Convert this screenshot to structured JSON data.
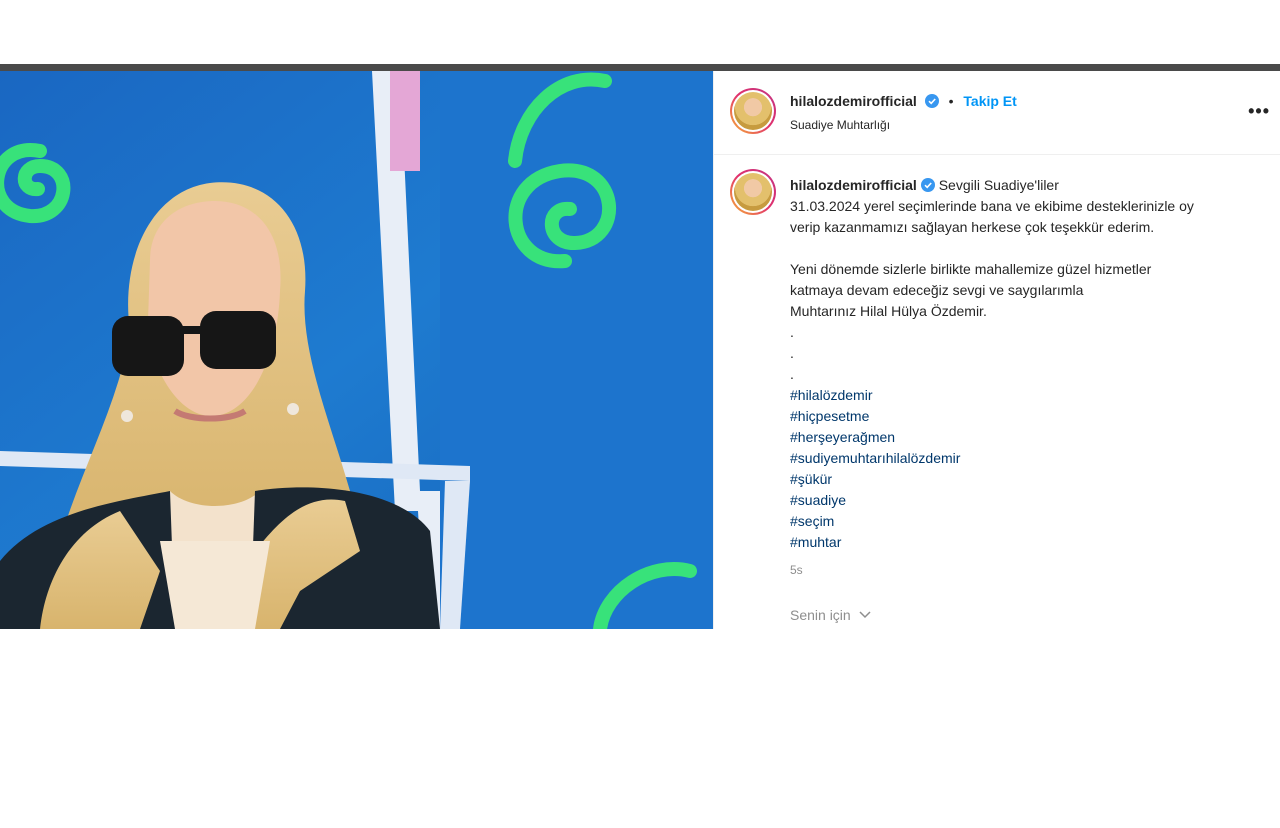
{
  "post": {
    "username": "hilalozdemirofficial",
    "follow_label": "Takip Et",
    "separator": "•",
    "location": "Suadiye Muhtarlığı",
    "more_label": "•••",
    "caption_lines": [
      "Sevgili Suadiye'liler",
      "31.03.2024 yerel seçimlerinde bana ve ekibime desteklerinizle oy",
      "verip kazanmamızı sağlayan herkese çok teşekkür ederim.",
      "",
      "Yeni dönemde sizlerle birlikte mahallemize güzel hizmetler",
      "katmaya devam edeceğiz sevgi ve saygılarımla",
      "Muhtarınız Hilal Hülya Özdemir.",
      ".",
      ".",
      "."
    ],
    "hashtags": [
      "#hilalözdemir",
      "#hiçpesetme",
      "#herşeyerağmen",
      "#sudiyemuhtarıhilalözdemir",
      "#şükür",
      "#suadiye",
      "#seçim",
      "#muhtar"
    ],
    "time": "5s",
    "for_you": "Senin için",
    "icons": {
      "verified": "verified-badge-icon",
      "more": "more-options-icon",
      "chevron": "chevron-down-icon"
    },
    "colors": {
      "link": "#0095f6",
      "hashtag": "#00376b",
      "muted": "#8e8e8e"
    }
  }
}
